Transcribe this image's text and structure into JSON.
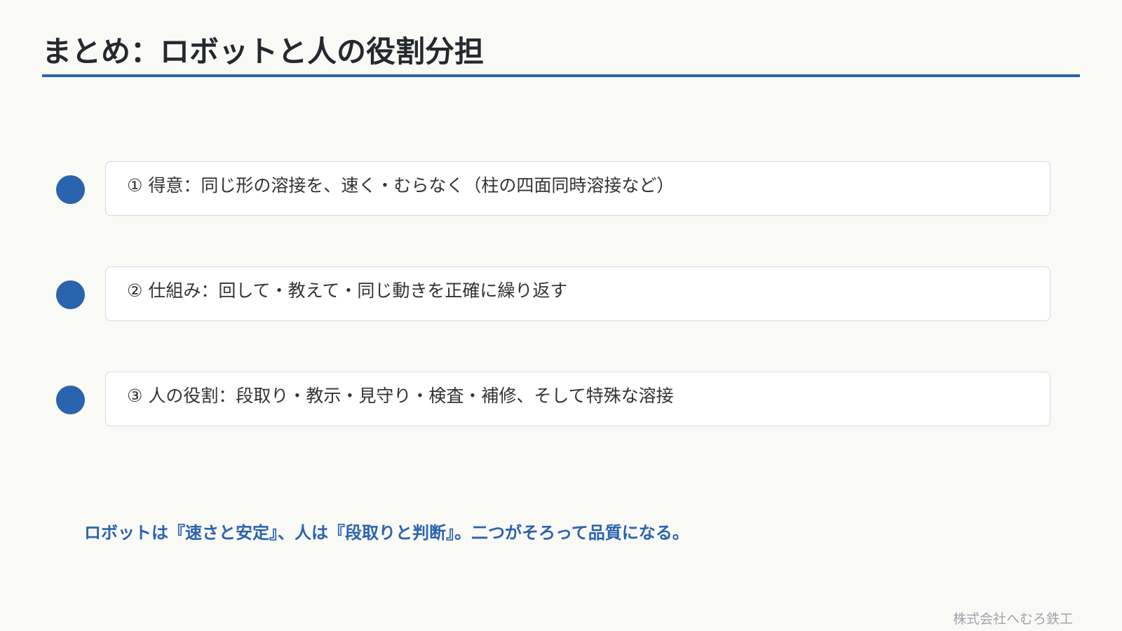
{
  "slide": {
    "title": "まとめ：ロボットと人の役割分担",
    "items": [
      {
        "text": "① 得意：同じ形の溶接を、速く・むらなく（柱の四面同時溶接など）"
      },
      {
        "text": "② 仕組み：回して・教えて・同じ動きを正確に繰り返す"
      },
      {
        "text": "③ 人の役割：段取り・教示・見守り・検査・補修、そして特殊な溶接"
      }
    ],
    "conclusion": "ロボットは『速さと安定』、人は『段取りと判断』。二つがそろって品質になる。",
    "footer": "株式会社へむろ鉄工"
  },
  "colors": {
    "accent": "#2a63ae",
    "background": "#f9f9f6",
    "title": "#24292f",
    "card_border": "#d6d9de",
    "footer": "#a0a4aa"
  }
}
